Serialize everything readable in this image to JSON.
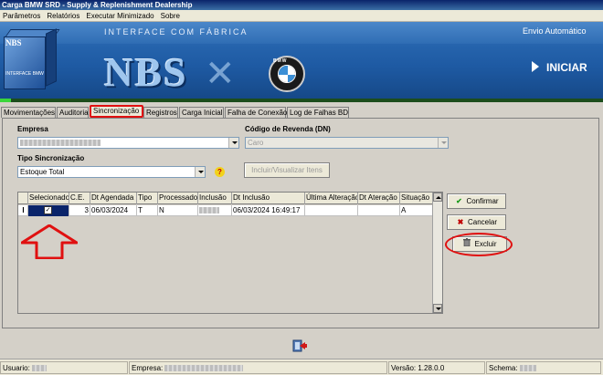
{
  "window": {
    "title": "Carga BMW SRD - Supply & Replenishment Dealership"
  },
  "menu": [
    "Parâmetros",
    "Relatórios",
    "Executar Minimizado",
    "Sobre"
  ],
  "banner": {
    "heading": "INTERFACE COM FÁBRICA",
    "mode": "Envio Automático",
    "logo_text": "NBS",
    "box_tag": "NBS",
    "box_caption": "INTERFACE BMW",
    "bmw_text": "BMW",
    "start_label": "INICIAR",
    "colors": {
      "banner": "#2e6fb8",
      "accent_green": "#3bd63b"
    }
  },
  "tabs": [
    {
      "label": "Movimentações",
      "active": false
    },
    {
      "label": "Auditoria",
      "active": false
    },
    {
      "label": "Sincronização",
      "active": true
    },
    {
      "label": "Registros",
      "active": false
    },
    {
      "label": "Carga Inicial",
      "active": false
    },
    {
      "label": "Falha de Conexão",
      "active": false
    },
    {
      "label": "Log de Falhas BD",
      "active": false
    }
  ],
  "form": {
    "empresa_label": "Empresa",
    "empresa_value": "",
    "codigo_label": "Código de Revenda (DN)",
    "codigo_value": "Caro",
    "tipo_label": "Tipo Sincronização",
    "tipo_value": "Estoque Total",
    "incluir_label": "Incluir/Visualizar Itens",
    "help_icon": "?"
  },
  "grid": {
    "columns": [
      "Selecionado",
      "C.E.",
      "Dt Agendada",
      "Tipo",
      "Processado",
      "Inclusão",
      "Dt Inclusão",
      "Última Alteração",
      "Dt Ateração",
      "Situação"
    ],
    "rows": [
      {
        "marker": "I",
        "selecionado": "✓",
        "ce": "3",
        "dt_agendada": "06/03/2024",
        "tipo": "T",
        "processado": "N",
        "inclusao": "",
        "dt_inclusao": "06/03/2024 16:49:17",
        "ultima_alteracao": "",
        "dt_alteracao": "",
        "situacao": "A"
      }
    ]
  },
  "actions": {
    "confirmar": "Confirmar",
    "cancelar": "Cancelar",
    "excluir": "Excluir",
    "confirm_icon": "✔",
    "cancel_icon": "✖"
  },
  "status": {
    "usuario_label": "Usuario:",
    "empresa_label": "Empresa:",
    "versao": "Versão: 1.28.0.0",
    "schema_label": "Schema:"
  },
  "annotation_colors": {
    "highlight": "#e01010"
  }
}
